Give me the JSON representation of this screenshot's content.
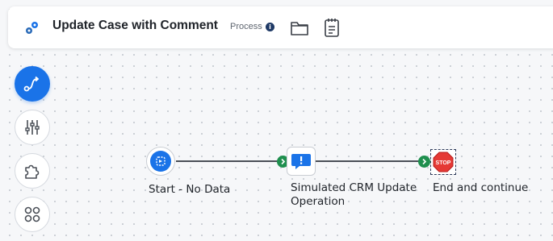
{
  "header": {
    "title": "Update Case with Comment",
    "type_label": "Process",
    "info_glyph": "i",
    "icons": [
      "process-icon",
      "info-icon",
      "folder-icon",
      "notes-icon"
    ]
  },
  "toolbar": {
    "items": [
      {
        "name": "flow-tool",
        "icon": "route-icon",
        "active": true
      },
      {
        "name": "settings-tool",
        "icon": "sliders-icon",
        "active": false
      },
      {
        "name": "plugins-tool",
        "icon": "puzzle-icon",
        "active": false
      },
      {
        "name": "apps-tool",
        "icon": "grid-icon",
        "active": false
      }
    ]
  },
  "flow": {
    "nodes": [
      {
        "label": "Start - No Data",
        "icon": "start-icon"
      },
      {
        "label_line1": "Simulated CRM Update",
        "label_line2": "Operation",
        "icon": "alert-chat-icon"
      },
      {
        "label": "End and continue",
        "icon": "stop-sign-icon",
        "sign_text": "STOP"
      }
    ]
  },
  "colors": {
    "accent": "#1a73e8",
    "connector_chevron": "#1f8f4e",
    "stop_red": "#e53935"
  }
}
